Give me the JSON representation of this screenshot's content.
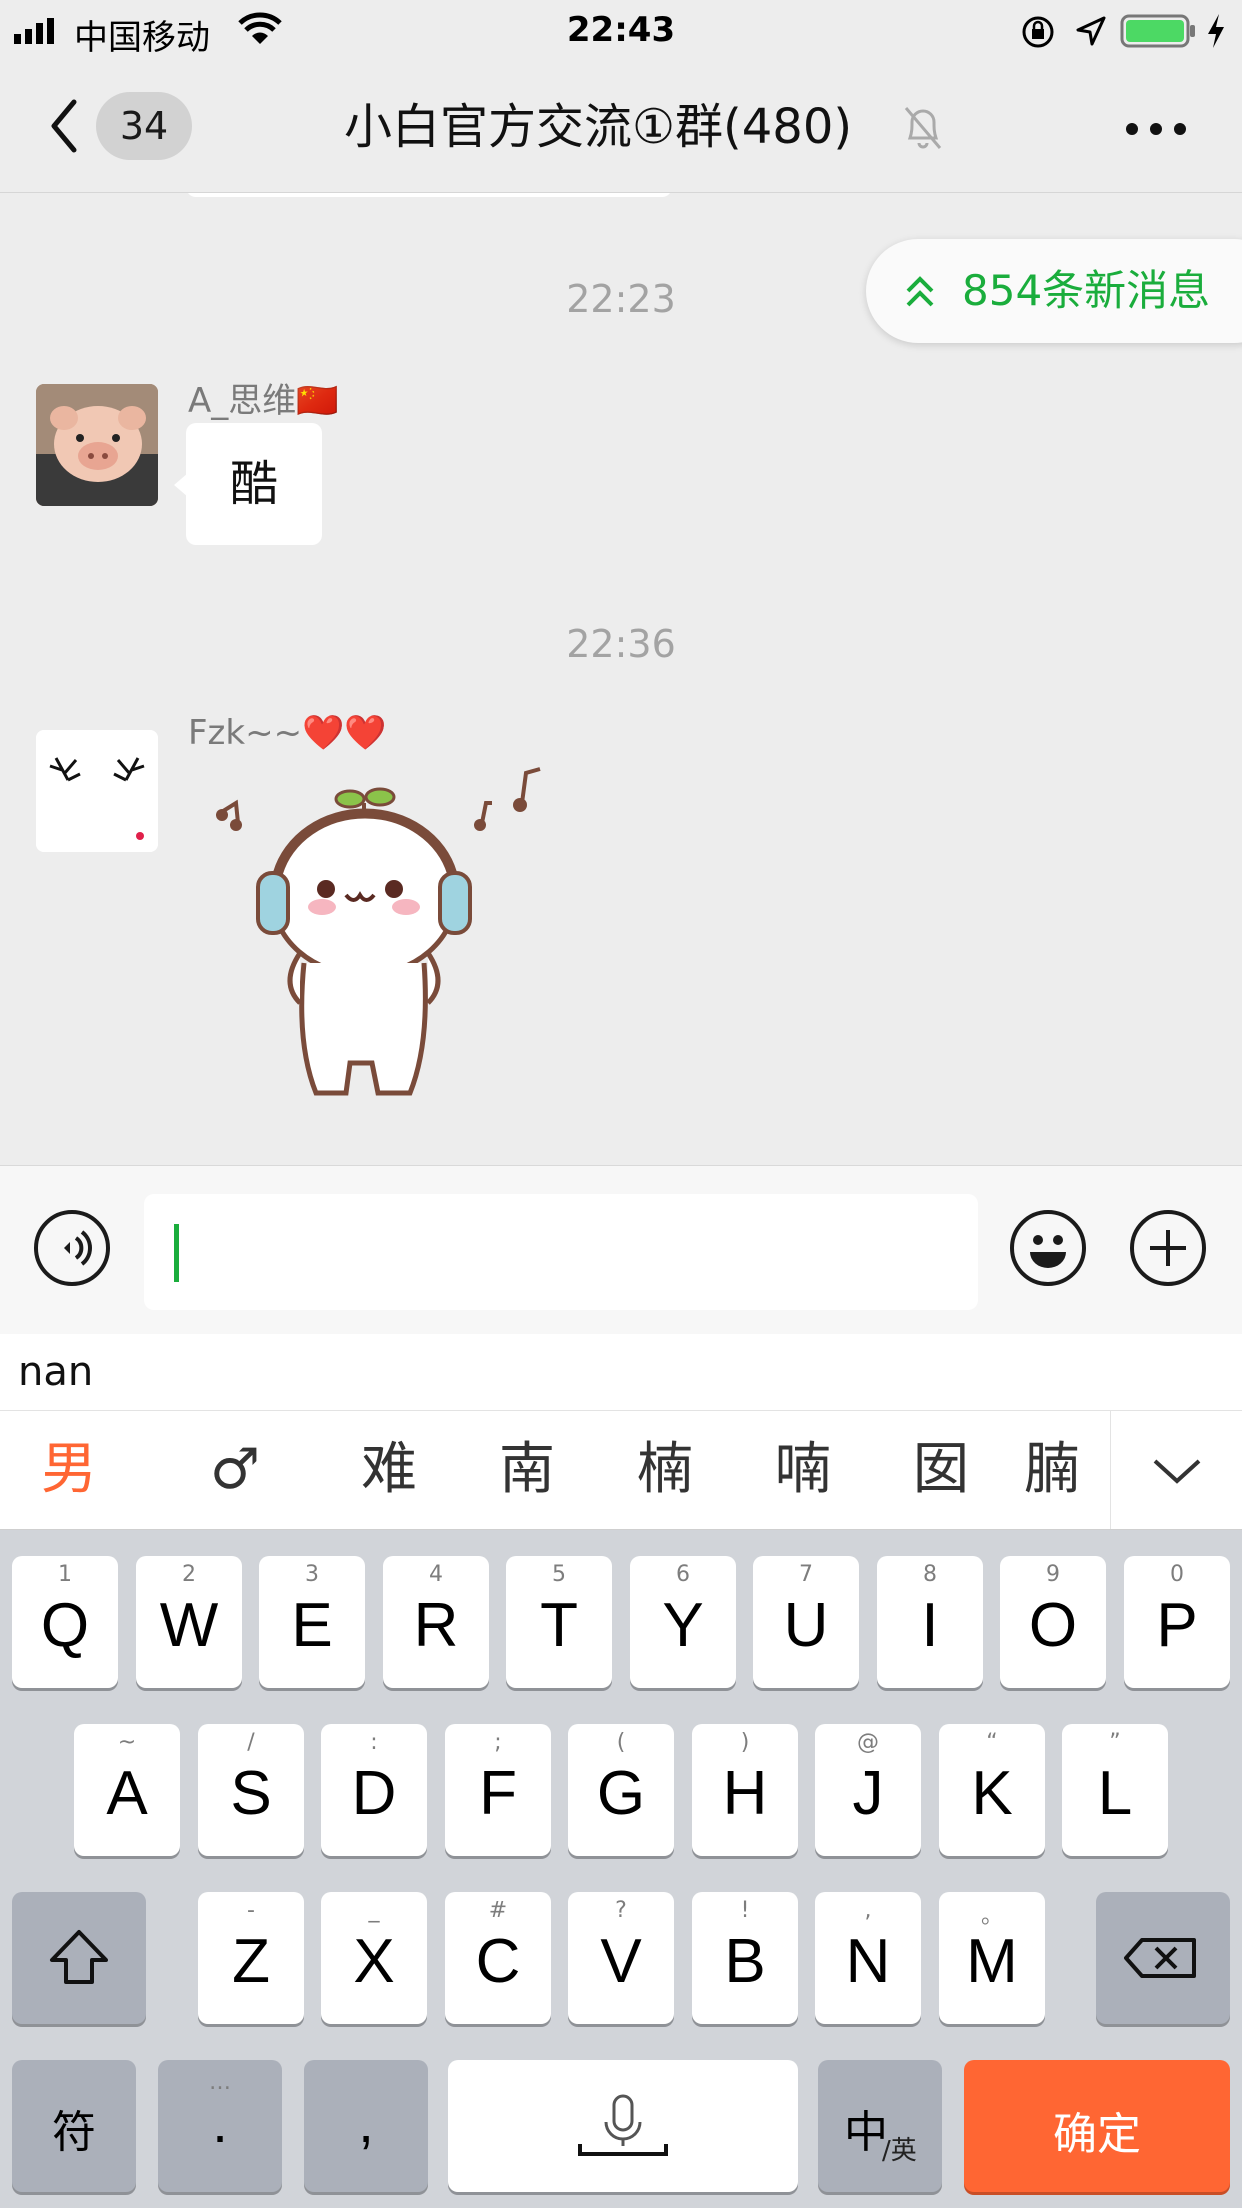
{
  "status_bar": {
    "carrier": "中国移动",
    "time": "22:43"
  },
  "nav": {
    "unread_count": "34",
    "title": "小白官方交流①群(480)"
  },
  "chat": {
    "new_messages_label": "854条新消息",
    "messages": [
      {
        "time": "22:23",
        "sender": "A_思维🇨🇳",
        "text": "酷"
      },
      {
        "time": "22:36",
        "sender": "Fzk~~❤️❤️",
        "sticker": "headphone-bun-sticker"
      }
    ]
  },
  "input": {
    "value": ""
  },
  "ime": {
    "pinyin": "nan",
    "candidates": [
      "男",
      "♂",
      "难",
      "南",
      "楠",
      "喃",
      "囡",
      "腩"
    ]
  },
  "keyboard": {
    "row1": [
      {
        "key": "Q",
        "sub": "1"
      },
      {
        "key": "W",
        "sub": "2"
      },
      {
        "key": "E",
        "sub": "3"
      },
      {
        "key": "R",
        "sub": "4"
      },
      {
        "key": "T",
        "sub": "5"
      },
      {
        "key": "Y",
        "sub": "6"
      },
      {
        "key": "U",
        "sub": "7"
      },
      {
        "key": "I",
        "sub": "8"
      },
      {
        "key": "O",
        "sub": "9"
      },
      {
        "key": "P",
        "sub": "0"
      }
    ],
    "row2": [
      {
        "key": "A",
        "sub": "~"
      },
      {
        "key": "S",
        "sub": "/"
      },
      {
        "key": "D",
        "sub": ":"
      },
      {
        "key": "F",
        "sub": ";"
      },
      {
        "key": "G",
        "sub": "("
      },
      {
        "key": "H",
        "sub": ")"
      },
      {
        "key": "J",
        "sub": "@"
      },
      {
        "key": "K",
        "sub": "“"
      },
      {
        "key": "L",
        "sub": "”"
      }
    ],
    "row3": [
      {
        "key": "Z",
        "sub": "-"
      },
      {
        "key": "X",
        "sub": "_"
      },
      {
        "key": "C",
        "sub": "#"
      },
      {
        "key": "V",
        "sub": "?"
      },
      {
        "key": "B",
        "sub": "!"
      },
      {
        "key": "N",
        "sub": ","
      },
      {
        "key": "M",
        "sub": "。"
      }
    ],
    "symbols_label": "符",
    "period_label": ".",
    "period_sub": "…",
    "comma_label": ",",
    "lang_label": "中",
    "lang_sub": "/英",
    "confirm_label": "确定"
  }
}
